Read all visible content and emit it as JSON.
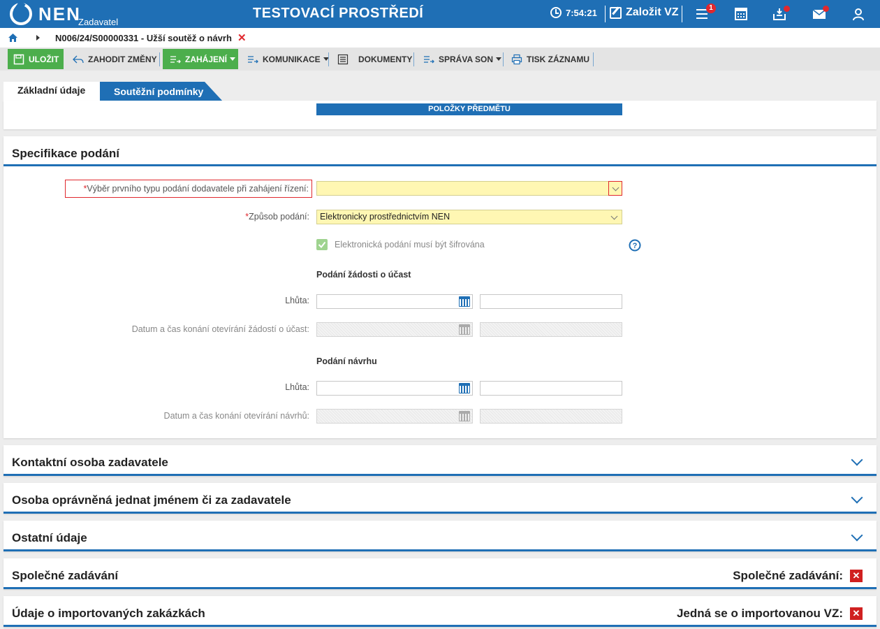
{
  "topbar": {
    "logo": "NEN",
    "logo_sub": "Zadavatel",
    "environment": "TESTOVACÍ PROSTŘEDÍ",
    "time": "7:54:21",
    "create_label": "Založit VZ",
    "menu_badge": "1",
    "accent": "#1f6fb5",
    "icons": [
      "clock-icon",
      "pen-icon",
      "menu-icon",
      "calculator-icon",
      "inbox-icon",
      "mail-icon",
      "user-icon"
    ]
  },
  "breadcrumb": {
    "text": "N006/24/S00000331 - Užší soutěž o návrh",
    "close": "✕"
  },
  "toolbar": {
    "save": "ULOŽIT",
    "discard": "ZAHODIT ZMĚNY",
    "start": "ZAHÁJENÍ",
    "communication": "KOMUNIKACE",
    "documents": "DOKUMENTY",
    "son": "SPRÁVA SON",
    "print": "TISK ZÁZNAMU"
  },
  "tabs": {
    "basic": "Základní údaje",
    "conditions": "Soutěžní podmínky"
  },
  "top_card": {
    "items_button": "POLOŽKY PŘEDMĚTU"
  },
  "spec": {
    "title": "Specifikace podání",
    "first_type_label": "Výběr prvního typu podání dodavatele při zahájení řízení:",
    "first_type_value": "",
    "mode_label": "Způsob podání:",
    "mode_value": "Elektronicky prostřednictvím NEN",
    "encrypt_label": "Elektronická podání musí být šifrována",
    "encrypt_checked": true,
    "requests_heading": "Podání žádosti o účast",
    "deadline_label": "Lhůta:",
    "requests_open_label": "Datum a čas konání otevírání žádostí o účast:",
    "proposals_heading": "Podání návrhu",
    "deadline_label2": "Lhůta:",
    "proposals_open_label": "Datum a čas konání otevírání návrhů:",
    "required_mark": "*"
  },
  "sections": {
    "contact": "Kontaktní osoba zadavatele",
    "authorized": "Osoba oprávněná jednat jménem či za zadavatele",
    "other": "Ostatní údaje",
    "joint": "Společné zadávání",
    "joint_flag_label": "Společné zadávání:",
    "imported": "Údaje o importovaných zakázkách",
    "imported_flag_label": "Jedná se o importovanou VZ:",
    "flag_value": "✕"
  }
}
